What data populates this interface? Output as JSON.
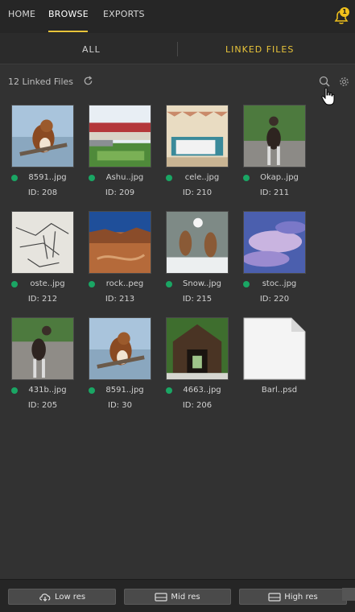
{
  "nav": {
    "tabs": [
      {
        "label": "HOME"
      },
      {
        "label": "BROWSE"
      },
      {
        "label": "EXPORTS"
      }
    ],
    "notification_count": "1",
    "accent": "#e8c43a"
  },
  "subtabs": {
    "all": "ALL",
    "linked": "LINKED FILES"
  },
  "header": {
    "count_label": "12 Linked Files"
  },
  "files": [
    {
      "name": "8591..jpg",
      "id": "ID: 208",
      "status": "linked",
      "icon": "squirrel-photo"
    },
    {
      "name": "Ashu..jpg",
      "id": "ID: 209",
      "status": "linked",
      "icon": "covered-bridge-photo"
    },
    {
      "name": "cele..jpg",
      "id": "ID: 210",
      "status": "linked",
      "icon": "bedroom-photo"
    },
    {
      "name": "Okap..jpg",
      "id": "ID: 211",
      "status": "linked",
      "icon": "okapi-photo"
    },
    {
      "name": "oste..jpg",
      "id": "ID: 212",
      "status": "linked",
      "icon": "sketch-photo"
    },
    {
      "name": "rock..peg",
      "id": "ID: 213",
      "status": "linked",
      "icon": "canyon-photo"
    },
    {
      "name": "Snow..jpg",
      "id": "ID: 215",
      "status": "linked",
      "icon": "squirrels-snow-photo"
    },
    {
      "name": "stoc..jpg",
      "id": "ID: 220",
      "status": "linked",
      "icon": "clouds-photo"
    },
    {
      "name": "431b..jpg",
      "id": "ID: 205",
      "status": "linked",
      "icon": "okapi-photo"
    },
    {
      "name": "8591..jpg",
      "id": "ID: 30",
      "status": "linked",
      "icon": "squirrel-photo"
    },
    {
      "name": "4663..jpg",
      "id": "ID: 206",
      "status": "linked",
      "icon": "wooden-bridge-photo"
    },
    {
      "name": "Barl..psd",
      "id": "",
      "status": "none",
      "icon": "generic-file-icon"
    }
  ],
  "bottom": {
    "low": "Low res",
    "mid": "Mid res",
    "high": "High res"
  }
}
